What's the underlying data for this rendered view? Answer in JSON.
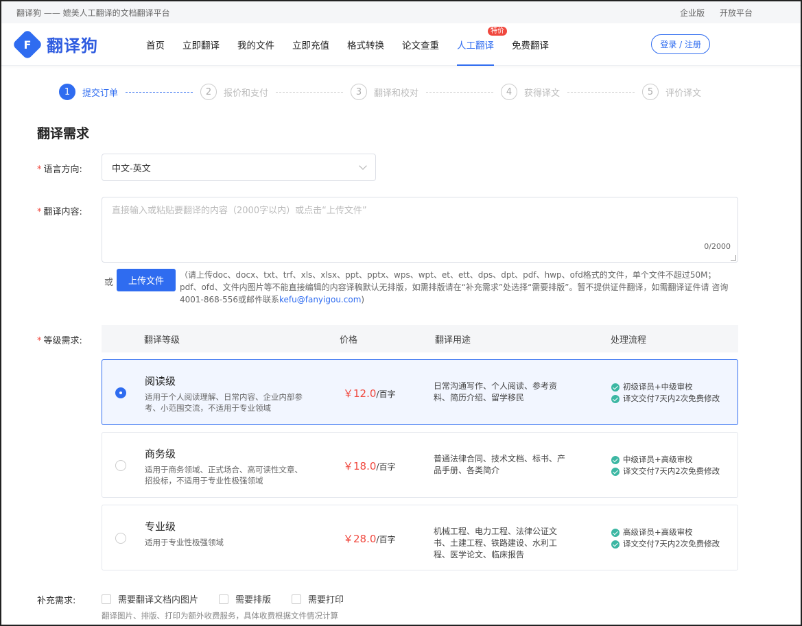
{
  "topbar": {
    "slogan": "翻译狗 —— 媲美人工翻译的文档翻译平台",
    "enterprise": "企业版",
    "open_platform": "开放平台"
  },
  "header": {
    "logo_mark": "F",
    "logo_text": "翻译狗",
    "nav": [
      "首页",
      "立即翻译",
      "我的文件",
      "立即充值",
      "格式转换",
      "论文查重",
      "人工翻译",
      "免费翻译"
    ],
    "nav_badge": "特价",
    "login": "登录 / 注册"
  },
  "steps": [
    {
      "num": "1",
      "label": "提交订单"
    },
    {
      "num": "2",
      "label": "报价和支付"
    },
    {
      "num": "3",
      "label": "翻译和校对"
    },
    {
      "num": "4",
      "label": "获得译文"
    },
    {
      "num": "5",
      "label": "评价译文"
    }
  ],
  "form": {
    "title": "翻译需求",
    "required_mark": "*",
    "lang_label": "语言方向:",
    "lang_value": "中文-英文",
    "content_label": "翻译内容:",
    "content_placeholder": "直接输入或粘贴要翻译的内容（2000字以内）或点击“上传文件”",
    "content_count": "0/2000",
    "or": "或",
    "upload_btn": "上传文件",
    "upload_note": "（请上传doc、docx、txt、trf、xls、xlsx、ppt、pptx、wps、wpt、et、ett、dps、dpt、pdf、hwp、ofd格式的文件，单个文件不超过50M；pdf、ofd、文件内图片等不能直接编辑的内容译稿默认无排版，如需排版请在“补充需求”处选择“需要排版”。暂不提供证件翻译，如需翻译证件请 咨询4001-868-556或邮件联系",
    "upload_mail": "kefu@fanyigou.com",
    "upload_close": ")",
    "grade_label": "等级需求:",
    "grade_headers": {
      "level": "翻译等级",
      "price": "价格",
      "use": "翻译用途",
      "flow": "处理流程"
    },
    "grades": [
      {
        "name": "阅读级",
        "desc": "适用于个人阅读理解、日常内容、企业内部参考、小范围交流，不适用于专业领域",
        "price": "￥12.0",
        "unit": "/百字",
        "use": "日常沟通写作、个人阅读、参考资料、简历介绍、留学移民",
        "flow1": "初级译员+中级审校",
        "flow2": "译文交付7天内2次免费修改",
        "selected": true
      },
      {
        "name": "商务级",
        "desc": "适用于商务领域、正式场合、高可读性文章、招投标，不适用于专业性极强领域",
        "price": "￥18.0",
        "unit": "/百字",
        "use": "普通法律合同、技术文档、标书、产品手册、各类简介",
        "flow1": "中级译员+高级审校",
        "flow2": "译文交付7天内2次免费修改",
        "selected": false
      },
      {
        "name": "专业级",
        "desc": "适用于专业性极强领域",
        "price": "￥28.0",
        "unit": "/百字",
        "use": "机械工程、电力工程、法律公证文书、土建工程、铁路建设、水利工程、医学论文、临床报告",
        "flow1": "高级译员+高级审校",
        "flow2": "译文交付7天内2次免费修改",
        "selected": false
      }
    ],
    "extra_label": "补充需求:",
    "extras": [
      "需要翻译文档内图片",
      "需要排版",
      "需要打印"
    ],
    "extras_note": "翻译图片、排版、打印为额外收费服务，具体收费根据文件情况计算"
  }
}
